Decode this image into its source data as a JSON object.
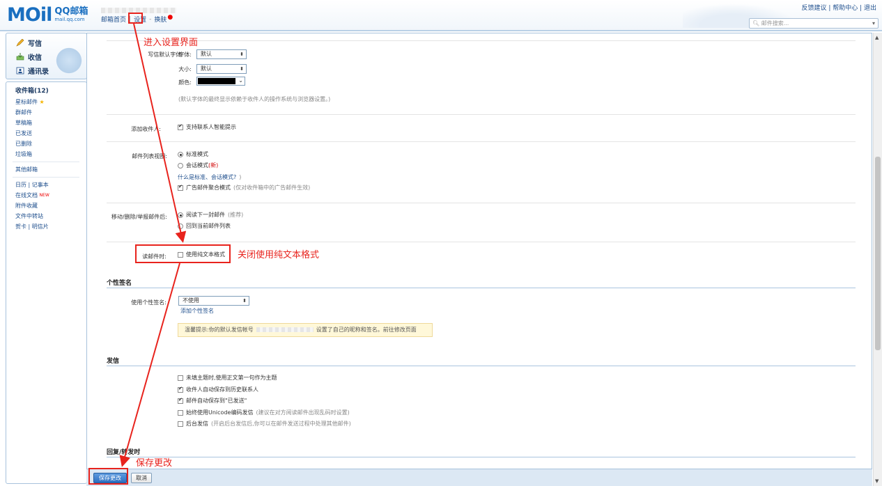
{
  "header": {
    "logo_mail": "MOil",
    "logo_cn": "QQ邮箱",
    "logo_domain": "mail.qq.com",
    "nav": [
      "邮箱首页",
      "设置",
      "换肤"
    ],
    "toplinks": "反馈建议 | 帮助中心 | 退出",
    "search_placeholder": "邮件搜索..."
  },
  "left": {
    "quick": [
      "写信",
      "收信",
      "通讯录"
    ],
    "folders": {
      "inbox": "收件箱(12)",
      "starred": "星标邮件",
      "group": "群邮件",
      "drafts": "草稿箱",
      "sent": "已发送",
      "deleted": "已删除",
      "spam": "垃圾箱",
      "other": "其他邮箱",
      "calendar": "日历",
      "notes": "记事本",
      "docs": "在线文档",
      "new_badge": "NEW",
      "attachments": "附件收藏",
      "transfer": "文件中转站",
      "cards": "贺卡",
      "postcards": "明信片"
    }
  },
  "settings": {
    "font_label": "写信默认字体:",
    "font_face_label": "字体:",
    "font_face_value": "默认",
    "font_size_label": "大小:",
    "font_size_value": "默认",
    "font_color_label": "颜色:",
    "font_note": "(默认字体的最终显示依赖于收件人的操作系统与浏览器设置。)",
    "add_recipient_label": "添加收件人:",
    "add_recipient_option": "支持联系人智能提示",
    "list_view_label": "邮件列表视图:",
    "list_view_standard": "标准模式",
    "list_view_conv": "会话模式",
    "list_view_conv_new": "(新)",
    "list_view_help": "什么是标准、会话模式?",
    "list_view_help_close": ")",
    "ad_merge": "广告邮件聚合模式",
    "ad_merge_note": "(仅对收件箱中的广告邮件生效)",
    "after_move_label": "移动/删除/举报邮件后:",
    "after_move_next": "阅读下一封邮件",
    "after_move_next_note": "(推荐)",
    "after_move_back": "回到当前邮件列表",
    "read_label": "读邮件时:",
    "read_option": "使用纯文本格式",
    "sig_section": "个性签名",
    "sig_label": "使用个性签名:",
    "sig_value": "不使用",
    "sig_add": "添加个性签名",
    "tip_prefix": "温馨提示:你的默认发信帐号",
    "tip_suffix": "设置了自己的昵称和签名。前往修改页面",
    "send_section": "发信",
    "send_opts": [
      {
        "label": "未填主题时,使用正文第一句作为主题",
        "checked": false,
        "note": ""
      },
      {
        "label": "收件人自动保存到历史联系人",
        "checked": true,
        "note": ""
      },
      {
        "label": "邮件自动保存到\"已发送\"",
        "checked": true,
        "note": ""
      },
      {
        "label": "始终使用Unicode编码发信",
        "checked": false,
        "note": "(建议在对方阅读邮件出现乱码时设置)"
      },
      {
        "label": "后台发信",
        "checked": false,
        "note": "(开启后台发信后,你可以在邮件发送过程中处理其他邮件)"
      }
    ],
    "reply_section": "回复/转发时"
  },
  "bottom": {
    "save": "保存更改",
    "cancel": "取消"
  },
  "annotations": {
    "a1": "进入设置界面",
    "a2": "关闭使用纯文本格式",
    "a3": "保存更改"
  },
  "colors": {
    "accent": "#1f4f8d",
    "annotation": "#e8231d",
    "primary_button": "#2d6fc0"
  }
}
